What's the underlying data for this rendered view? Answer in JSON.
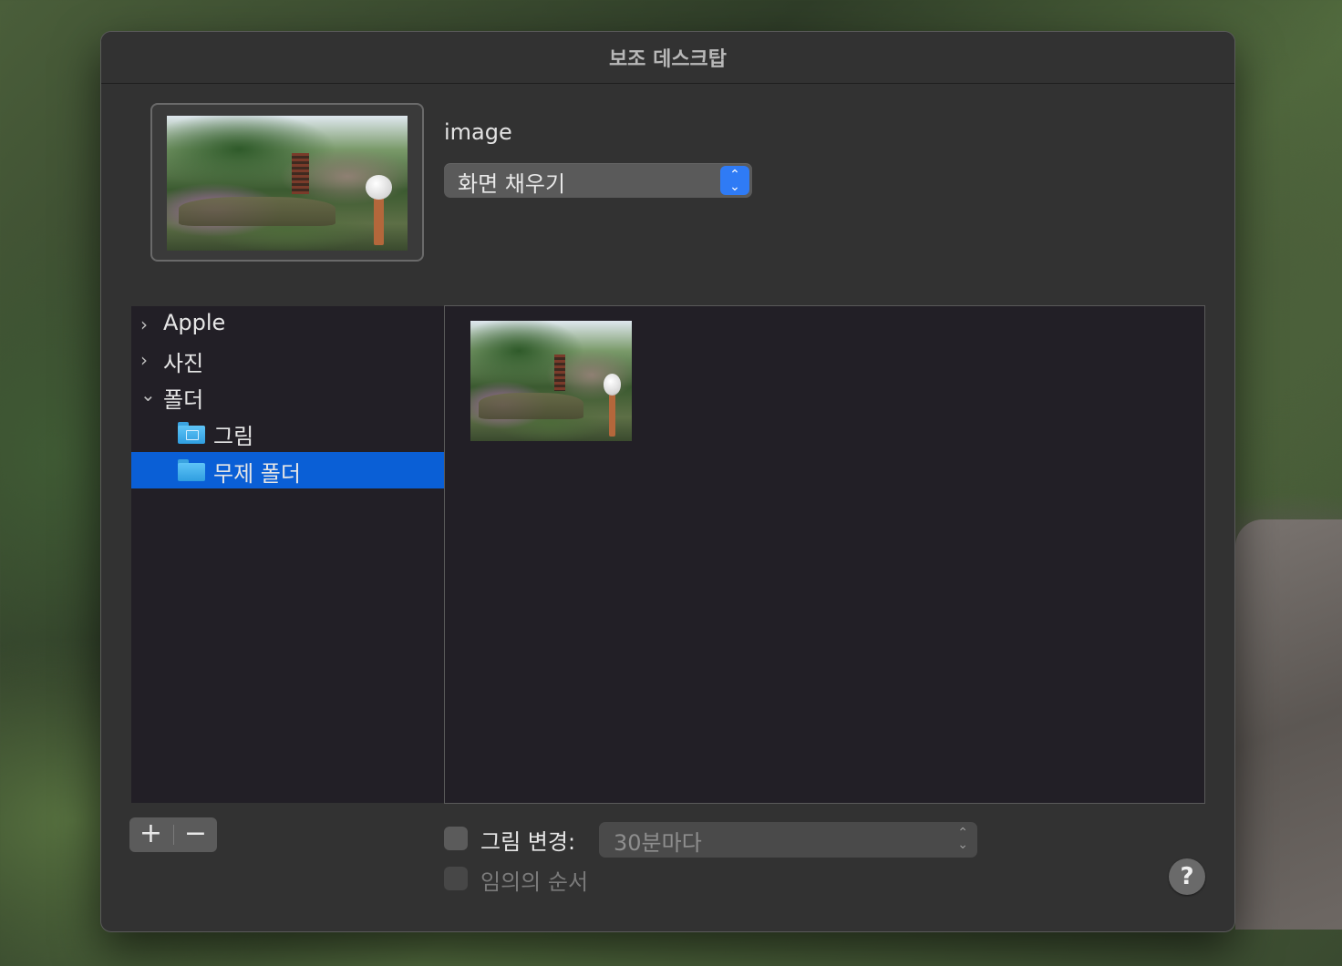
{
  "window": {
    "title": "보조 데스크탑"
  },
  "preview": {
    "image_name": "image"
  },
  "fit_popup": {
    "selected": "화면 채우기"
  },
  "sidebar": {
    "items": [
      {
        "label": "Apple",
        "expanded": false
      },
      {
        "label": "사진",
        "expanded": false
      },
      {
        "label": "폴더",
        "expanded": true
      }
    ],
    "subitems": [
      {
        "label": "그림",
        "icon": "pictures-folder-icon"
      },
      {
        "label": "무제 폴더",
        "icon": "folder-icon",
        "selected": true
      }
    ]
  },
  "buttons": {
    "add": "+",
    "remove": "−",
    "help": "?"
  },
  "options": {
    "change_picture": {
      "label": "그림 변경:",
      "checked": false
    },
    "interval": {
      "selected": "30분마다"
    },
    "random_order": {
      "label": "임의의 순서",
      "checked": false,
      "enabled": false
    }
  },
  "colors": {
    "accent": "#0a5fd6",
    "popup_accent": "#2f7bf5"
  }
}
